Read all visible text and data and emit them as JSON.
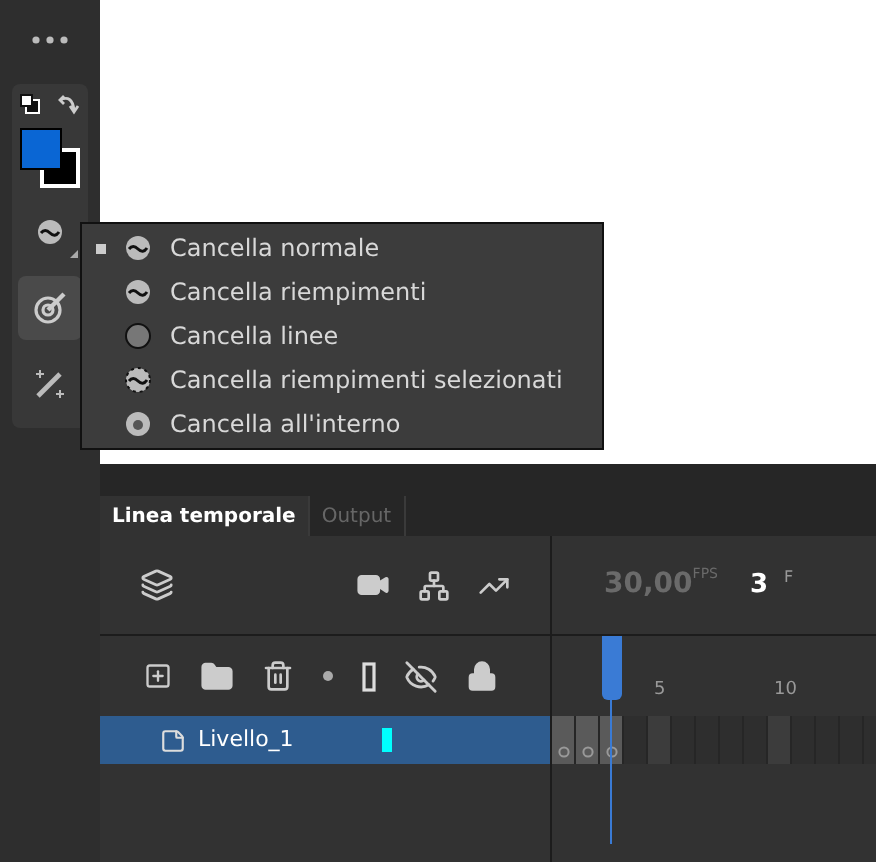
{
  "tools": [
    {
      "kind": "eraser",
      "selected": false,
      "flyout": true
    },
    {
      "kind": "brush",
      "selected": true,
      "flyout": false
    },
    {
      "kind": "wand",
      "selected": false,
      "flyout": false
    }
  ],
  "eraser_menu": {
    "items": [
      {
        "label": "Cancella normale",
        "selected": true
      },
      {
        "label": "Cancella riempimenti",
        "selected": false
      },
      {
        "label": "Cancella linee",
        "selected": false
      },
      {
        "label": "Cancella riempimenti selezionati",
        "selected": false
      },
      {
        "label": "Cancella all'interno",
        "selected": false
      }
    ]
  },
  "timeline": {
    "tabs": [
      {
        "label": "Linea temporale",
        "selected": true
      },
      {
        "label": "Output",
        "selected": false
      }
    ],
    "fps": "30,00",
    "fps_unit": "FPS",
    "frame": "3",
    "frame_unit": "F",
    "ruler_labels": [
      "5",
      "10"
    ],
    "layers": [
      {
        "name": "Livello_1",
        "selected": true,
        "color": "#00ffff"
      }
    ]
  }
}
